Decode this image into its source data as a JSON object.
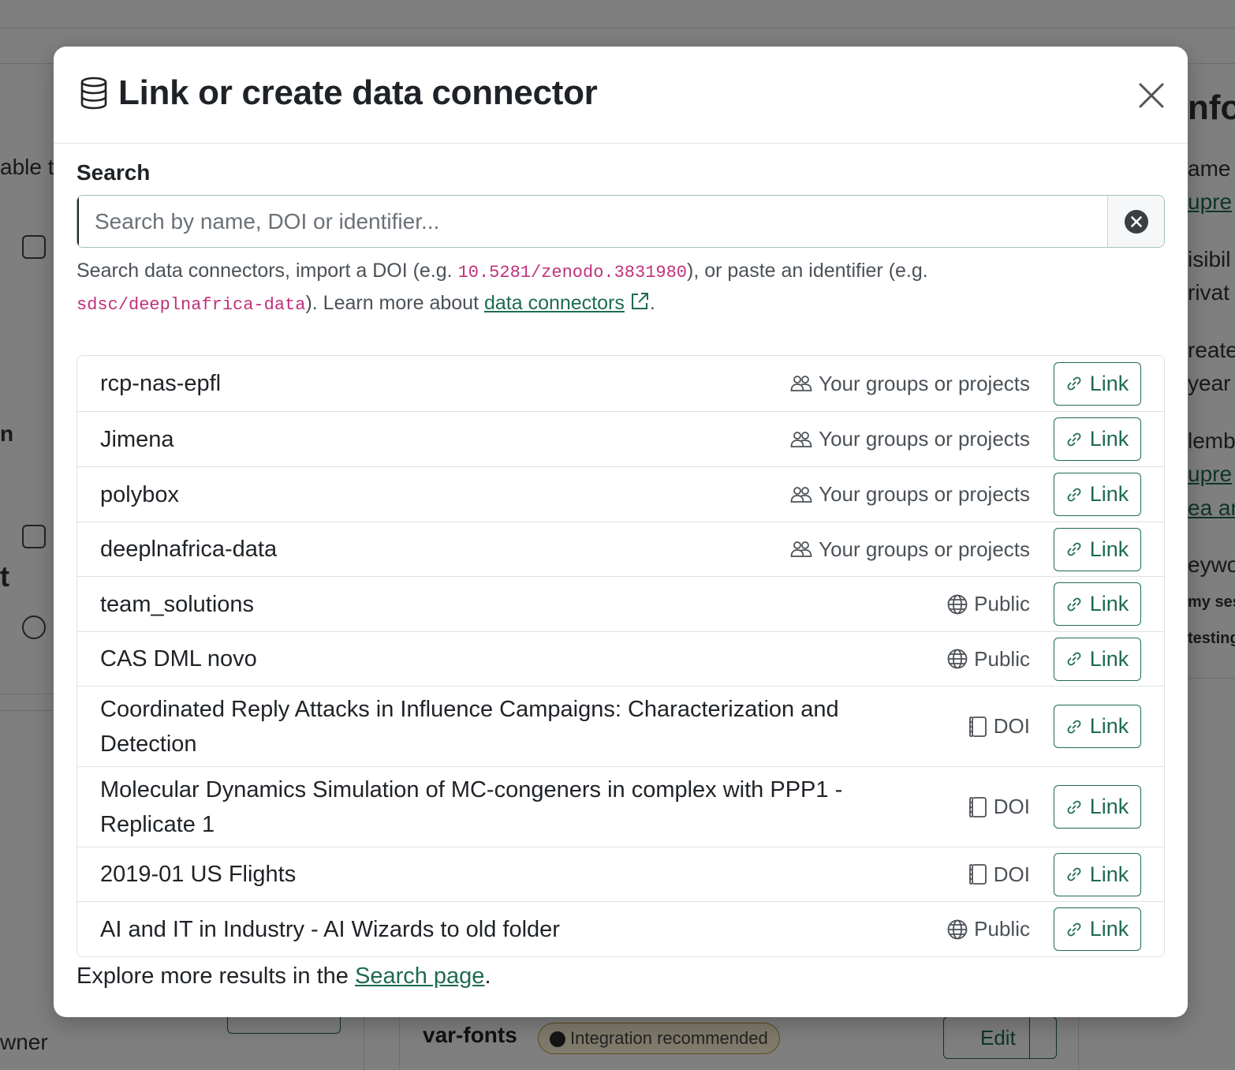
{
  "modal": {
    "title": "Link or create data connector",
    "search_label": "Search",
    "search_placeholder": "Search by name, DOI or identifier...",
    "search_value": "",
    "help": {
      "part1": "Search data connectors, import a DOI (e.g. ",
      "doi_example": "10.5281/zenodo.3831980",
      "part2": "), or paste an identifier (e.g. ",
      "identifier_example": "sdsc/deeplnafrica-data",
      "part3": "). Learn more about ",
      "link_text": "data connectors",
      "part4": "."
    },
    "results": [
      {
        "name": "rcp-nas-epfl",
        "tag": "Your groups or projects",
        "icon": "people-icon",
        "action": "Link"
      },
      {
        "name": "Jimena",
        "tag": "Your groups or projects",
        "icon": "people-icon",
        "action": "Link"
      },
      {
        "name": "polybox",
        "tag": "Your groups or projects",
        "icon": "people-icon",
        "action": "Link"
      },
      {
        "name": "deeplnafrica-data",
        "tag": "Your groups or projects",
        "icon": "people-icon",
        "action": "Link"
      },
      {
        "name": "team_solutions",
        "tag": "Public",
        "icon": "globe-icon",
        "action": "Link"
      },
      {
        "name": "CAS DML novo",
        "tag": "Public",
        "icon": "globe-icon",
        "action": "Link"
      },
      {
        "name": "Coordinated Reply Attacks in Influence Campaigns: Characterization and Detection",
        "tag": "DOI",
        "icon": "journal-icon",
        "action": "Link"
      },
      {
        "name": "Molecular Dynamics Simulation of MC-congeners in complex with PPP1 - Replicate 1",
        "tag": "DOI",
        "icon": "journal-icon",
        "action": "Link"
      },
      {
        "name": "2019-01 US Flights",
        "tag": "DOI",
        "icon": "journal-icon",
        "action": "Link"
      },
      {
        "name": "AI and IT in Industry - AI Wizards to old folder",
        "tag": "Public",
        "icon": "globe-icon",
        "action": "Link"
      }
    ],
    "footer": {
      "prefix": "Explore more results in the ",
      "link_text": "Search page",
      "suffix": "."
    }
  },
  "background": {
    "left_texts": [
      "able t",
      "n",
      "t",
      "wner"
    ],
    "right_texts": [
      "nfo",
      "ame",
      "upre",
      "isibil",
      "rivat",
      "reate",
      "year",
      "lemb",
      "upre",
      "ea an",
      "eywo",
      "my ses",
      "testing"
    ],
    "project_title": "var-fonts",
    "badge": "Integration recommended",
    "edit_label": "Edit"
  },
  "colors": {
    "accent": "#1e6b52",
    "code": "#c0317a"
  }
}
